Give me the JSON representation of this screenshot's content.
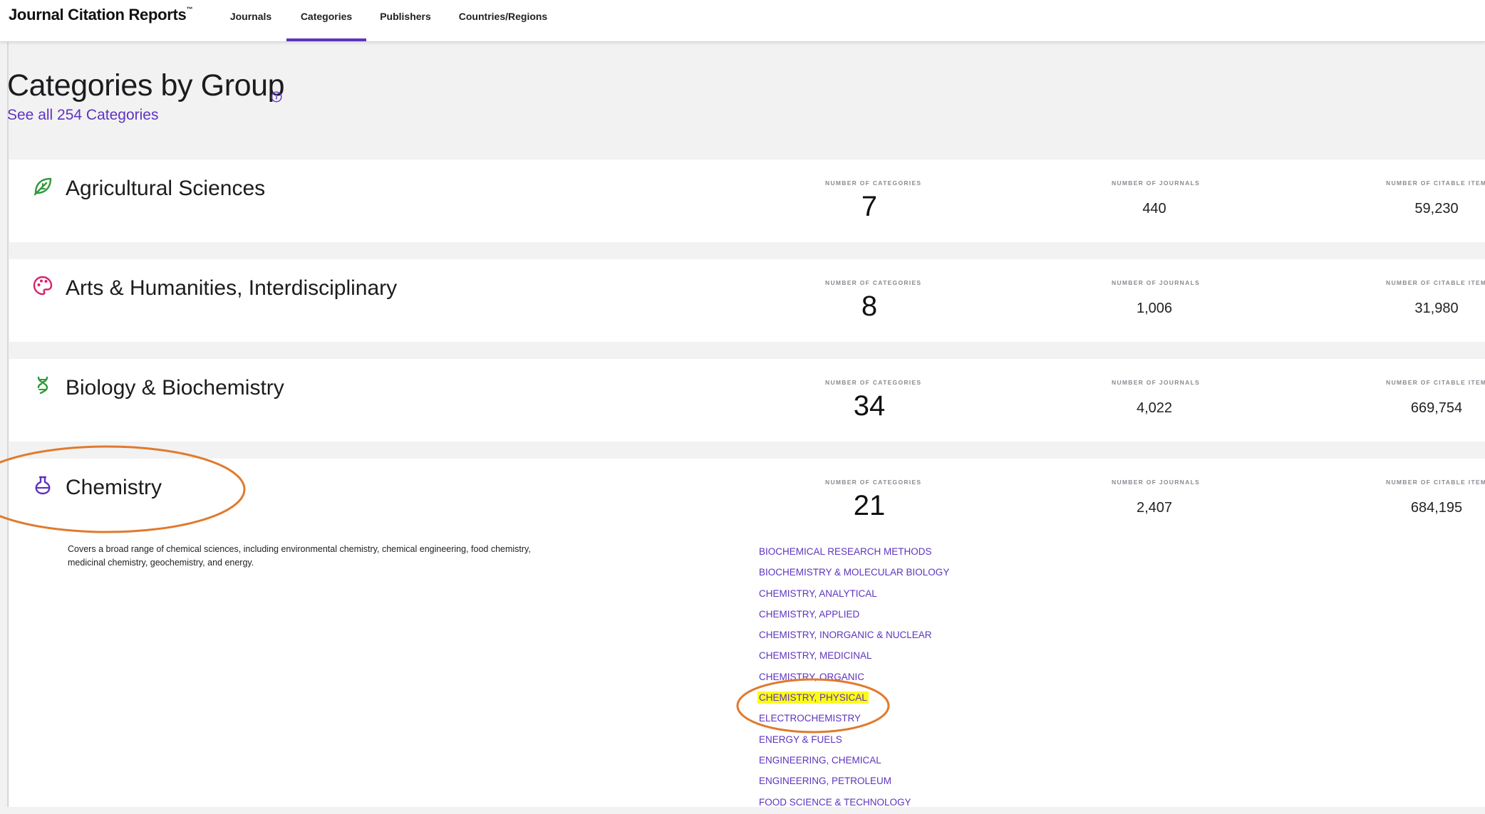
{
  "header": {
    "brand": "Journal Citation Reports",
    "brand_tm": "™",
    "tabs": [
      {
        "label": "Journals",
        "active": false
      },
      {
        "label": "Categories",
        "active": true
      },
      {
        "label": "Publishers",
        "active": false
      },
      {
        "label": "Countries/Regions",
        "active": false
      }
    ]
  },
  "page": {
    "title": "Categories by Group",
    "see_all": "See all 254 Categories",
    "info_icon": "info-circle-icon"
  },
  "stat_labels": {
    "categories": "NUMBER OF CATEGORIES",
    "journals": "NUMBER OF JOURNALS",
    "citable": "NUMBER OF CITABLE ITEMS"
  },
  "groups": [
    {
      "name": "Agricultural Sciences",
      "icon": "leaf-icon",
      "icon_color": "#2e9a3a",
      "categories": "7",
      "journals": "440",
      "citable": "59,230"
    },
    {
      "name": "Arts & Humanities, Interdisciplinary",
      "icon": "palette-icon",
      "icon_color": "#d6246e",
      "categories": "8",
      "journals": "1,006",
      "citable": "31,980"
    },
    {
      "name": "Biology & Biochemistry",
      "icon": "dna-icon",
      "icon_color": "#2e9a3a",
      "categories": "34",
      "journals": "4,022",
      "citable": "669,754"
    },
    {
      "name": "Chemistry",
      "icon": "flask-icon",
      "icon_color": "#5e33bf",
      "categories": "21",
      "journals": "2,407",
      "citable": "684,195",
      "description": "Covers a broad range of chemical sciences, including environmental chemistry, chemical engineering, food chemistry, medicinal chemistry, geochemistry, and energy.",
      "category_list": [
        "BIOCHEMICAL RESEARCH METHODS",
        "BIOCHEMISTRY & MOLECULAR BIOLOGY",
        "CHEMISTRY, ANALYTICAL",
        "CHEMISTRY, APPLIED",
        "CHEMISTRY, INORGANIC & NUCLEAR",
        "CHEMISTRY, MEDICINAL",
        "CHEMISTRY, ORGANIC",
        "CHEMISTRY, PHYSICAL",
        "ELECTROCHEMISTRY",
        "ENERGY & FUELS",
        "ENGINEERING, CHEMICAL",
        "ENGINEERING, PETROLEUM",
        "FOOD SCIENCE & TECHNOLOGY"
      ],
      "highlighted": "CHEMISTRY, PHYSICAL"
    }
  ],
  "colors": {
    "accent": "#5e33bf",
    "highlight": "#fbfb19",
    "annotation": "#e07a2e"
  }
}
